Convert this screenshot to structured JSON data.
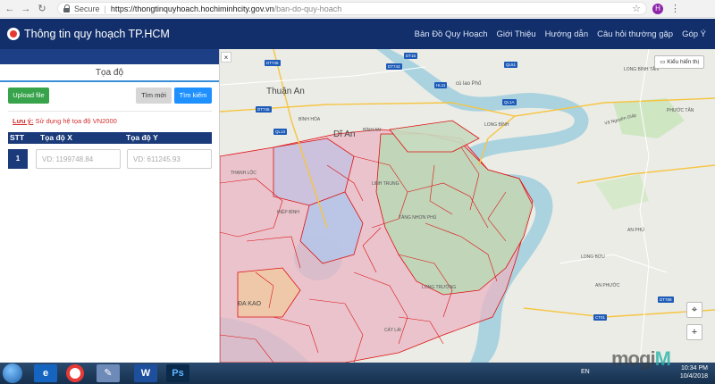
{
  "browser": {
    "secure_label": "Secure",
    "url_host": "https://thongtinquyhoach.hochiminhcity.gov.vn",
    "url_path": "/ban-do-quy-hoach",
    "profile_initial": "H"
  },
  "header": {
    "title": "Thông tin quy hoạch TP.HCM",
    "menu": [
      "Bản Đồ Quy Hoạch",
      "Giới Thiệu",
      "Hướng dẫn",
      "Câu hỏi thường gặp",
      "Góp Ý"
    ]
  },
  "panel": {
    "heading": "Tọa độ",
    "upload_label": "Upload file",
    "new_label": "Tìm mới",
    "search_label": "Tìm kiếm",
    "note_prefix": "Lưu ý:",
    "note_text": "Sử dụng hệ tọa độ VN2000",
    "col_stt": "STT",
    "col_x": "Tọa độ X",
    "col_y": "Tọa độ Y",
    "row_number": "1",
    "x_placeholder": "VD: 1199748.84",
    "y_placeholder": "VD: 611245.93"
  },
  "map": {
    "close_label": "×",
    "layer_label": "Kiểu hiển thị",
    "locate_label": "⌖",
    "zoom_in_label": "+",
    "places": {
      "thuan_an": "Thuận An",
      "di_an": "Dĩ An",
      "cu_lao_pho": "cù lao Phố",
      "long_binh": "LONG BÌNH",
      "binh_hoa": "BÌNH HÒA",
      "binh_an": "BÌNH AN",
      "an_phu": "AN PHÚ",
      "long_binh_tan": "LONG BÌNH TÂN",
      "linh_trung": "LINH TRUNG",
      "tang_nhon_phu": "TĂNG NHƠN PHÚ",
      "long_truong": "LONG TRƯỜNG",
      "cat_lai": "CÁT LÁI",
      "da_kao": "ĐA KAO",
      "long_buu": "LONG BỬU",
      "an_phuoc": "AN PHƯỚC",
      "phuoc_tan": "PHƯỚC TÂN",
      "thanh_loc": "THẠNH LỘC",
      "hiep_binh": "HIỆP BÌNH",
      "vo_nguyen_giap": "Võ Nguyên Giáp"
    },
    "roads": [
      "DT745",
      "DT743",
      "DT746",
      "QL13",
      "QL1A",
      "DT16",
      "HL11",
      "QL51",
      "DT768",
      "CT01"
    ]
  },
  "taskbar": {
    "lang": "EN",
    "time": "10:34 PM",
    "date": "10/4/2018"
  },
  "watermark": {
    "main": "mogi",
    "accent": "M"
  }
}
